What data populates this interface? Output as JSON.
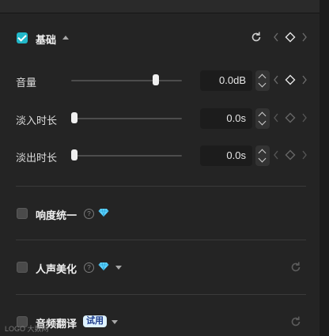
{
  "basic": {
    "title": "基础",
    "checked": true
  },
  "volume": {
    "label": "音量",
    "value": "0.0dB",
    "level": 0.78
  },
  "fade_in": {
    "label": "淡入时长",
    "value": "0.0s",
    "level": 0
  },
  "fade_out": {
    "label": "淡出时长",
    "value": "0.0s",
    "level": 0
  },
  "loudness": {
    "label": "响度统一"
  },
  "voice_beautify": {
    "label": "人声美化"
  },
  "audio_translate": {
    "label": "音频翻译",
    "badge": "试用"
  },
  "help_glyph": "?",
  "watermark": "LOGO 大数网",
  "colors": {
    "accent": "#22b8c9",
    "gem": "#5ed3ff"
  }
}
